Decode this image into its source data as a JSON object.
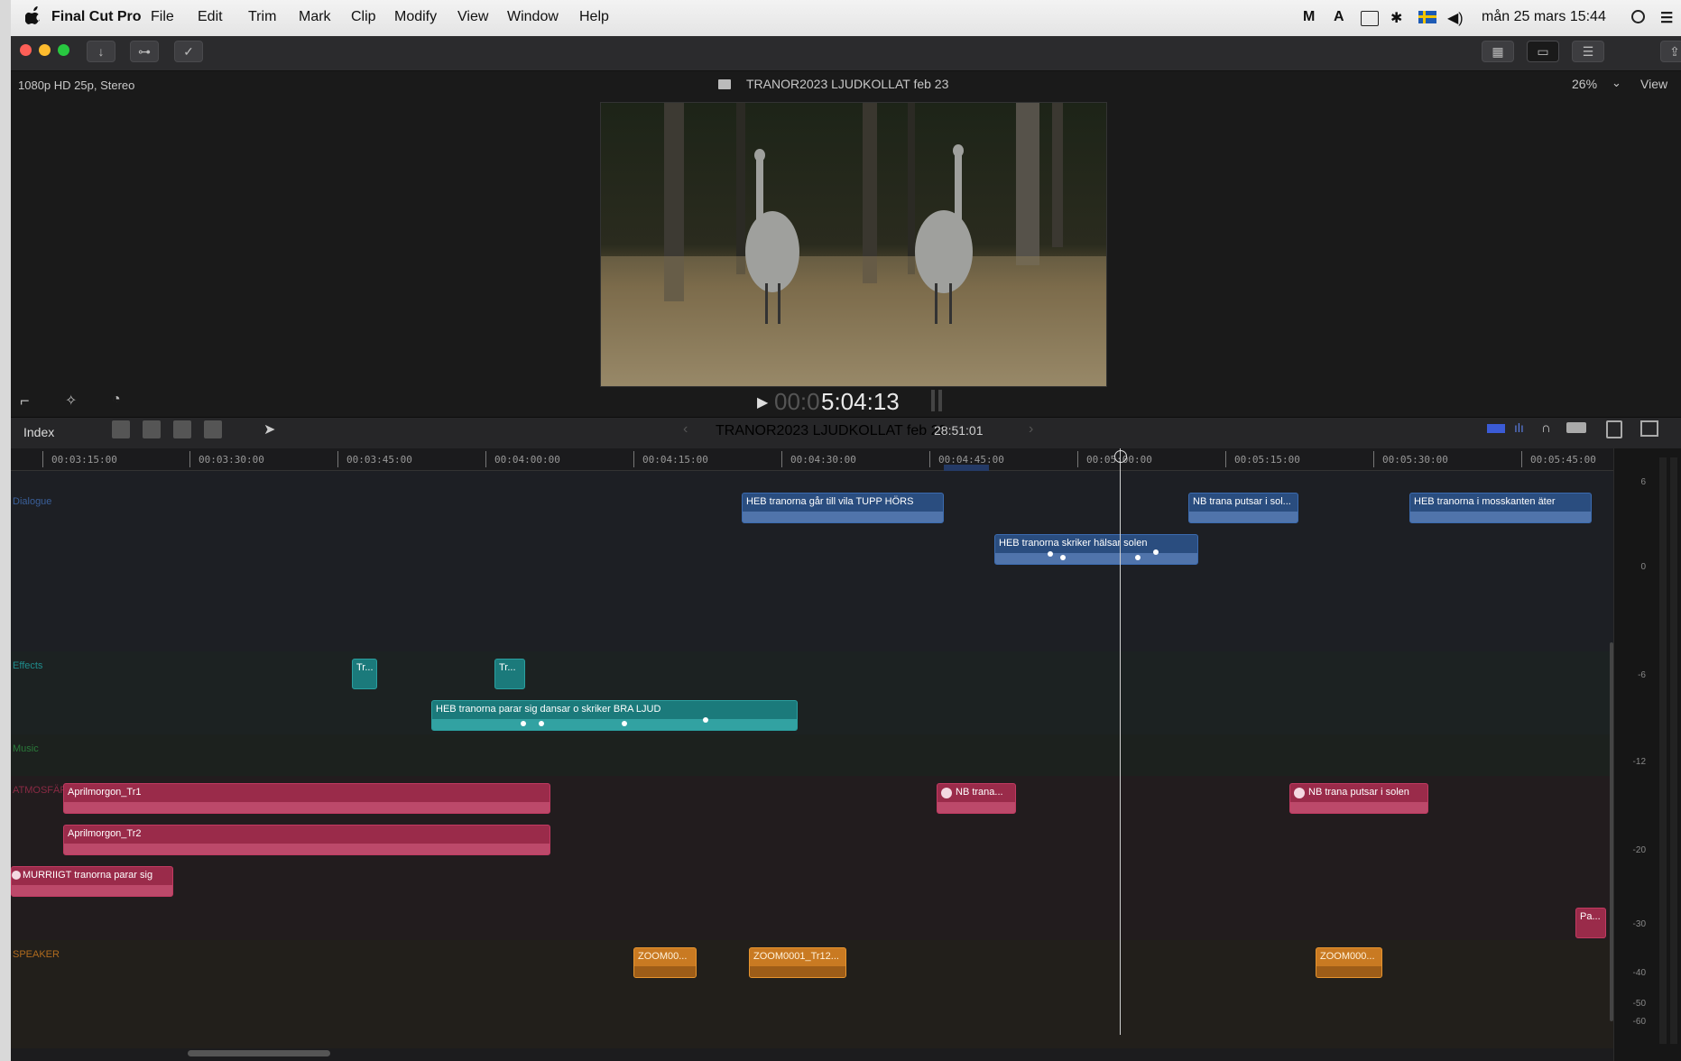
{
  "menubar": {
    "app": "Final Cut Pro",
    "items": [
      "File",
      "Edit",
      "Trim",
      "Mark",
      "Clip",
      "Modify",
      "View",
      "Window",
      "Help"
    ],
    "clock": "mån 25 mars  15:44"
  },
  "viewer": {
    "format": "1080p HD 25p, Stereo",
    "title": "TRANOR2023 LJUDKOLLAT feb 23",
    "zoom": "26%",
    "view": "View",
    "timecode_dim": "00:0",
    "timecode": "5:04:13"
  },
  "timeline": {
    "index": "Index",
    "project": "TRANOR2023 LJUDKOLLAT feb 23",
    "duration": "28:51:01",
    "ruler": [
      "00:03:15:00",
      "00:03:30:00",
      "00:03:45:00",
      "00:04:00:00",
      "00:04:15:00",
      "00:04:30:00",
      "00:04:45:00",
      "00:05:00:00",
      "00:05:15:00",
      "00:05:30:00",
      "00:05:45:00"
    ],
    "lanes": {
      "dialogue": "Dialogue",
      "effects": "Effects",
      "music": "Music",
      "atmos": "ATMOSFÄR",
      "speaker": "SPEAKER"
    },
    "clips": {
      "c1": "HEB tranorna går till vila TUPP HÖRS",
      "c2": "NB trana putsar i sol...",
      "c3": "HEB tranorna i mosskanten äter",
      "c4": "HEB tranorna skriker hälsar solen",
      "c5": "Tr...",
      "c6": "Tr...",
      "c7": "HEB tranorna parar sig dansar o skriker BRA LJUD",
      "c8": "Aprilmorgon_Tr1",
      "c9": "NB trana...",
      "c10": "NB trana putsar i solen",
      "c11": "Aprilmorgon_Tr2",
      "c12": "MURRIIGT tranorna parar sig",
      "c13": "Pa...",
      "c14": "ZOOM00...",
      "c15": "ZOOM0001_Tr12...",
      "c16": "ZOOM000..."
    },
    "meter_scale": [
      "6",
      "0",
      "-6",
      "-12",
      "-20",
      "-30",
      "-40",
      "-50",
      "-60"
    ]
  },
  "colors": {
    "dialogue": "#2a4d7f",
    "effects": "#1b7a7b",
    "atmos": "#9a2b4a",
    "speaker": "#c97a22"
  }
}
